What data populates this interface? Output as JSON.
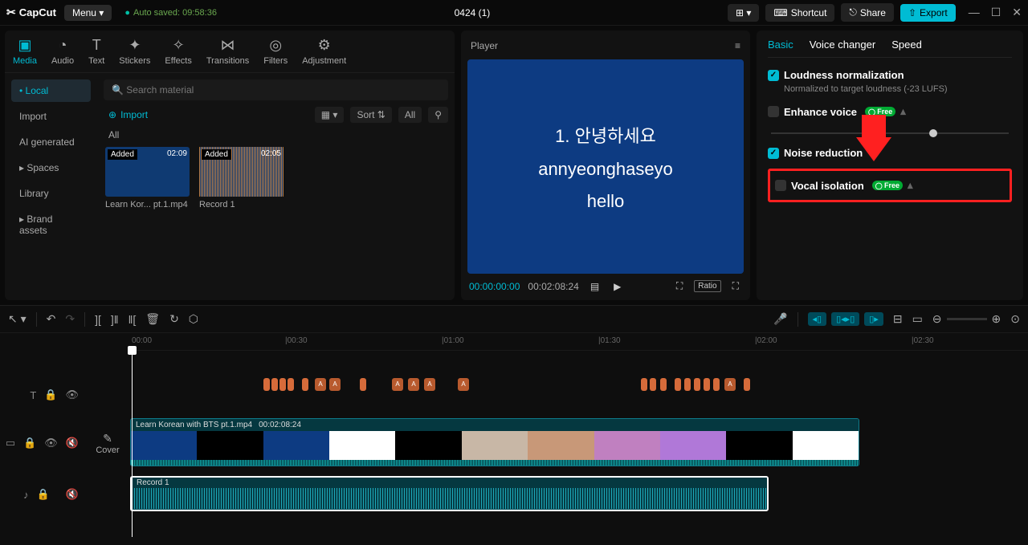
{
  "app": {
    "name": "CapCut",
    "menu": "Menu ▾",
    "autosave": "Auto saved: 09:58:36",
    "project": "0424 (1)"
  },
  "titlebar_buttons": {
    "layout": "⊞ ▾",
    "shortcut": "Shortcut",
    "share": "Share",
    "export": "Export"
  },
  "tool_tabs": [
    {
      "icon": "▣",
      "label": "Media",
      "active": true
    },
    {
      "icon": "◔",
      "label": "Audio"
    },
    {
      "icon": "T",
      "label": "Text"
    },
    {
      "icon": "✦",
      "label": "Stickers"
    },
    {
      "icon": "✧",
      "label": "Effects"
    },
    {
      "icon": "⋈",
      "label": "Transitions"
    },
    {
      "icon": "◎",
      "label": "Filters"
    },
    {
      "icon": "⚙",
      "label": "Adjustment"
    }
  ],
  "left_nav": [
    "• Local",
    "Import",
    "AI generated",
    "▸ Spaces",
    "Library",
    "▸ Brand assets"
  ],
  "search_placeholder": "Search material",
  "import_label": "Import",
  "view": {
    "sort": "Sort ⇅",
    "all": "All",
    "filter": "⚲"
  },
  "all_label": "All",
  "media_items": [
    {
      "added": "Added",
      "duration": "02:09",
      "name": "Learn Kor... pt.1.mp4",
      "type": "video"
    },
    {
      "added": "Added",
      "duration": "02:05",
      "name": "Record 1",
      "type": "audio"
    }
  ],
  "player": {
    "title": "Player",
    "line1": "1. 안녕하세요",
    "line2": "annyeonghaseyo",
    "line3": "hello",
    "cur_time": "00:00:00:00",
    "total_time": "00:02:08:24",
    "ratio": "Ratio"
  },
  "inspector": {
    "tabs": [
      "Basic",
      "Voice changer",
      "Speed"
    ],
    "loudness": {
      "label": "Loudness normalization",
      "sub": "Normalized to target loudness (-23 LUFS)",
      "checked": true
    },
    "enhance": {
      "label": "Enhance voice",
      "free": "Free",
      "checked": false
    },
    "noise": {
      "label": "Noise reduction",
      "checked": true
    },
    "vocal": {
      "label": "Vocal isolation",
      "free": "Free",
      "checked": false
    }
  },
  "ruler": [
    "00:00",
    "|00:30",
    "|01:00",
    "|01:30",
    "|02:00",
    "|02:30"
  ],
  "video_clip": {
    "name": "Learn Korean with BTS pt.1.mp4",
    "dur": "00:02:08:24"
  },
  "audio_clip": {
    "name": "Record 1"
  },
  "cover_label": "Cover"
}
